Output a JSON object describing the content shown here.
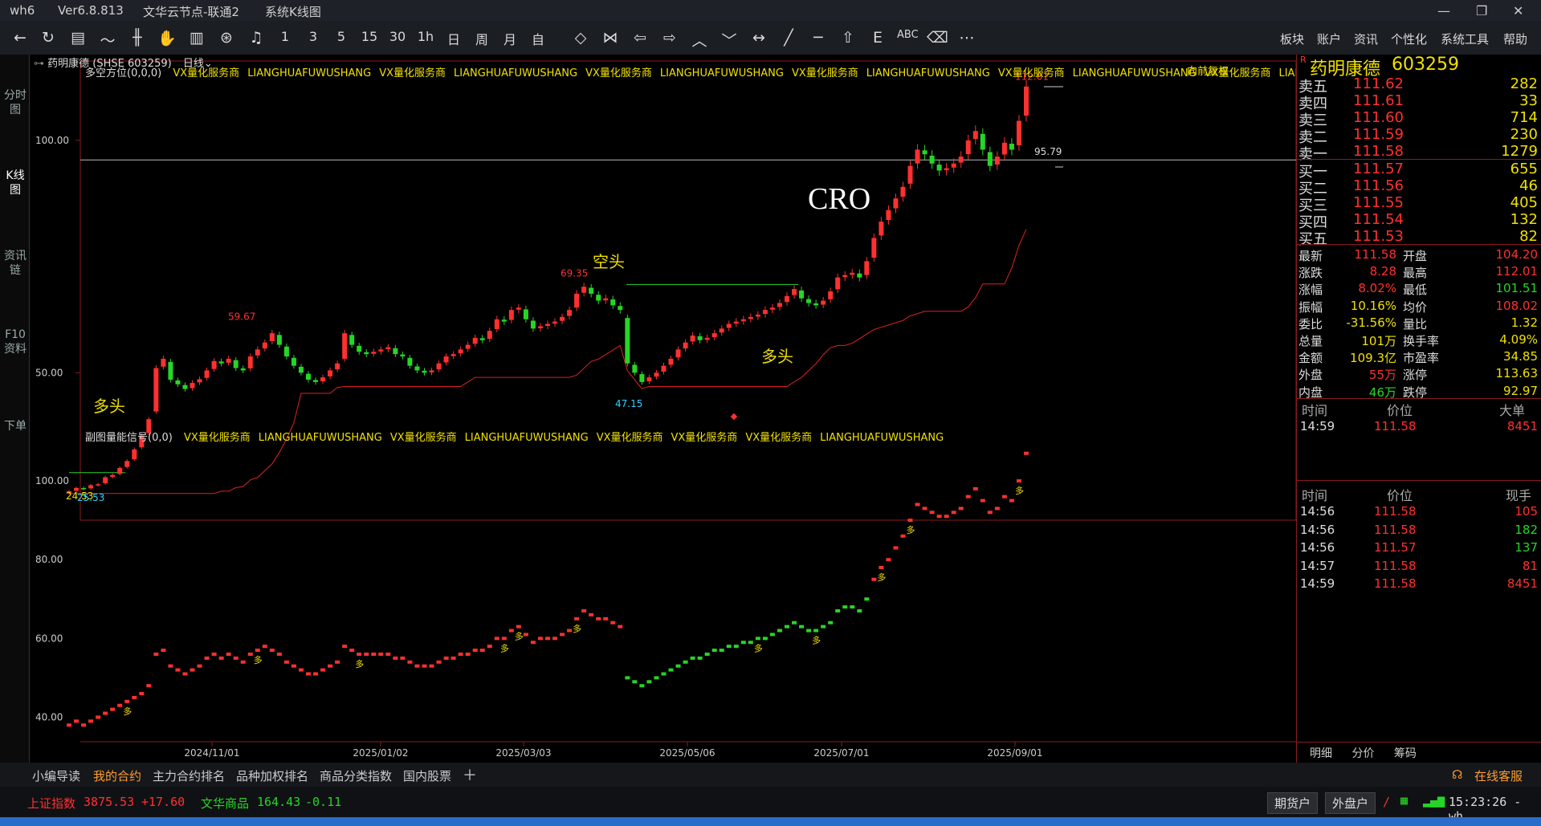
{
  "app": {
    "name": "wh6",
    "version": "Ver6.8.813",
    "server": "文华云节点-联通2",
    "view": "系统K线图"
  },
  "colors": {
    "up": "#ff3030",
    "down": "#26d626",
    "accent": "#f0e000",
    "bg": "#000000"
  },
  "toolbar": {
    "icons": [
      "back-icon",
      "refresh-icon",
      "table-icon",
      "line-chart-icon",
      "candle-icon",
      "hand-icon",
      "draw-icon",
      "speed-icon",
      "bell-icon"
    ],
    "periods": [
      "1",
      "3",
      "5",
      "15",
      "30",
      "1h",
      "日",
      "周",
      "月",
      "自"
    ],
    "menu": [
      "板块",
      "账户",
      "资讯",
      "个性化",
      "系统工具",
      "帮助"
    ]
  },
  "left_tabs": [
    "分时图",
    "K线图",
    "资讯链",
    "F10资料",
    "下单"
  ],
  "header": {
    "symbol": "药明康德",
    "code": "(SHSE 603259)",
    "period": "日线"
  },
  "main_chart": {
    "indicator": "多空方位(0,0,0)",
    "ad_text": [
      "VX量化服务商",
      "LIANGHUAFUWUSHANG",
      "VX量化服务商",
      "LIANGHUAFUWUSHANG",
      "VX量化服务商",
      "LIANGHUAFUWUSHANG",
      "VX量化服务商",
      "LIANGHUAFUWUSHANG",
      "VX量化服务商",
      "LIANGHUAFUWUSHANG",
      "VX量化服务商",
      "LIANGHUAFUWUSHANG"
    ],
    "rights_label": "向前复权",
    "max_label": "112.01",
    "price_line_label": "95.79",
    "peak1": "59.67",
    "peak2": "69.35",
    "low1": "47.15",
    "low_start": "24.53",
    "low_start2": "25.53",
    "annotation_cro": "CRO",
    "annotation_short": "空头",
    "annotation_long": "多头",
    "annotation_long2": "多头"
  },
  "sub_chart": {
    "indicator": "副图量能信号(0,0)",
    "ad_text": [
      "VX量化服务商",
      "LIANGHUAFUWUSHANG",
      "VX量化服务商",
      "LIANGHUAFUWUSHANG",
      "VX量化服务商",
      "VX量化服务商",
      "VX量化服务商",
      "LIANGHUAFUWUSHANG"
    ],
    "yticks": [
      "100.00",
      "80.00",
      "60.00",
      "40.00"
    ],
    "signal": "多"
  },
  "xaxis": [
    "2024/11/01",
    "2025/01/02",
    "2025/03/03",
    "2025/05/06",
    "2025/07/01",
    "2025/09/01"
  ],
  "chart_data": {
    "type": "candlestick",
    "title": "药明康德 603259 日线",
    "yticks": [
      "100.00",
      "50.00"
    ],
    "closes": [
      24.5,
      25.2,
      25.0,
      25.8,
      26.0,
      27.5,
      28.0,
      29.5,
      31.0,
      33.5,
      36.5,
      40.0,
      51.0,
      53.0,
      48.5,
      47.5,
      46.5,
      47.8,
      48.6,
      50.5,
      52.5,
      52.0,
      53.0,
      51.0,
      50.5,
      53.5,
      55.0,
      56.5,
      58.5,
      56.0,
      53.5,
      51.5,
      50.0,
      48.5,
      48.0,
      49.0,
      50.5,
      52.0,
      58.5,
      56.0,
      54.5,
      54.0,
      54.5,
      55.0,
      55.5,
      54.0,
      53.5,
      51.5,
      50.5,
      50.0,
      50.5,
      52.0,
      53.5,
      54.0,
      55.0,
      56.0,
      57.5,
      57.0,
      59.0,
      61.5,
      61.0,
      63.5,
      64.0,
      61.5,
      59.5,
      60.0,
      60.5,
      61.0,
      62.0,
      63.5,
      67.0,
      68.5,
      67.0,
      65.5,
      66.0,
      64.5,
      63.5,
      52.0,
      50.0,
      48.0,
      49.0,
      50.0,
      51.5,
      53.0,
      55.0,
      56.5,
      58.0,
      57.0,
      57.5,
      58.5,
      59.5,
      60.5,
      61.0,
      61.5,
      62.0,
      62.5,
      63.5,
      64.0,
      65.0,
      66.5,
      68.0,
      66.0,
      65.0,
      64.5,
      65.5,
      67.5,
      70.5,
      71.0,
      71.5,
      70.5,
      74.0,
      79.0,
      82.5,
      85.0,
      87.5,
      90.0,
      94.5,
      98.0,
      97.0,
      95.0,
      93.5,
      94.0,
      95.0,
      96.5,
      100.0,
      102.0,
      98.0,
      94.5,
      96.5,
      99.5,
      98.0,
      104.2,
      111.58
    ],
    "price_range": [
      20,
      115
    ],
    "sub_values": [
      38,
      39,
      38,
      39,
      40,
      41,
      42,
      43,
      44,
      45,
      46,
      48,
      56,
      57,
      53,
      52,
      51,
      52,
      53,
      55,
      56,
      55,
      56,
      55,
      54,
      56,
      57,
      58,
      57,
      56,
      54,
      53,
      52,
      51,
      51,
      52,
      53,
      54,
      58,
      57,
      56,
      56,
      56,
      56,
      56,
      55,
      55,
      54,
      53,
      53,
      53,
      54,
      55,
      55,
      56,
      56,
      57,
      57,
      58,
      60,
      60,
      62,
      63,
      61,
      59,
      60,
      60,
      60,
      61,
      62,
      65,
      67,
      66,
      65,
      65,
      64,
      63,
      50,
      49,
      48,
      49,
      50,
      51,
      52,
      53,
      54,
      55,
      55,
      56,
      57,
      57,
      58,
      58,
      59,
      59,
      60,
      60,
      61,
      62,
      63,
      64,
      63,
      62,
      62,
      63,
      64,
      67,
      68,
      68,
      67,
      70,
      75,
      78,
      80,
      83,
      86,
      90,
      94,
      93,
      92,
      91,
      91,
      92,
      93,
      96,
      98,
      95,
      92,
      93,
      96,
      95,
      100,
      107
    ],
    "sub_range": [
      35,
      110
    ]
  },
  "quote": {
    "title": "药明康德",
    "code": "603259",
    "asks": [
      {
        "label": "卖五",
        "price": "111.62",
        "vol": "282"
      },
      {
        "label": "卖四",
        "price": "111.61",
        "vol": "33"
      },
      {
        "label": "卖三",
        "price": "111.60",
        "vol": "714"
      },
      {
        "label": "卖二",
        "price": "111.59",
        "vol": "230"
      },
      {
        "label": "卖一",
        "price": "111.58",
        "vol": "1279"
      }
    ],
    "bids": [
      {
        "label": "买一",
        "price": "111.57",
        "vol": "655"
      },
      {
        "label": "买二",
        "price": "111.56",
        "vol": "46"
      },
      {
        "label": "买三",
        "price": "111.55",
        "vol": "405"
      },
      {
        "label": "买四",
        "price": "111.54",
        "vol": "132"
      },
      {
        "label": "买五",
        "price": "111.53",
        "vol": "82"
      }
    ],
    "stats": [
      {
        "l1": "最新",
        "v1": "111.58",
        "c1": "red",
        "l2": "开盘",
        "v2": "104.20",
        "c2": "red"
      },
      {
        "l1": "涨跌",
        "v1": "8.28",
        "c1": "red",
        "l2": "最高",
        "v2": "112.01",
        "c2": "red"
      },
      {
        "l1": "涨幅",
        "v1": "8.02%",
        "c1": "red",
        "l2": "最低",
        "v2": "101.51",
        "c2": "green"
      },
      {
        "l1": "振幅",
        "v1": "10.16%",
        "c1": "yellow",
        "l2": "均价",
        "v2": "108.02",
        "c2": "red"
      },
      {
        "l1": "委比",
        "v1": "-31.56%",
        "c1": "yellow",
        "l2": "量比",
        "v2": "1.32",
        "c2": "yellow"
      },
      {
        "l1": "总量",
        "v1": "101万",
        "c1": "yellow",
        "l2": "换手率",
        "v2": "4.09%",
        "c2": "yellow"
      },
      {
        "l1": "金额",
        "v1": "109.3亿",
        "c1": "yellow",
        "l2": "市盈率",
        "v2": "34.85",
        "c2": "yellow"
      },
      {
        "l1": "外盘",
        "v1": "55万",
        "c1": "red",
        "l2": "涨停",
        "v2": "113.63",
        "c2": "yellow"
      },
      {
        "l1": "内盘",
        "v1": "46万",
        "c1": "green",
        "l2": "跌停",
        "v2": "92.97",
        "c2": "yellow"
      }
    ],
    "big_header": [
      "时间",
      "价位",
      "大单"
    ],
    "big_rows": [
      {
        "t": "14:59",
        "p": "111.58",
        "v": "8451"
      }
    ],
    "tick_header": [
      "时间",
      "价位",
      "现手"
    ],
    "ticks": [
      {
        "t": "14:56",
        "p": "111.58",
        "v": "105"
      },
      {
        "t": "14:56",
        "p": "111.58",
        "v": "182"
      },
      {
        "t": "14:56",
        "p": "111.57",
        "v": "137"
      },
      {
        "t": "14:57",
        "p": "111.58",
        "v": "81"
      },
      {
        "t": "14:59",
        "p": "111.58",
        "v": "8451"
      }
    ],
    "bottom_tabs": [
      "明细",
      "分价",
      "筹码"
    ]
  },
  "bottom_tabs": [
    "小编导读",
    "我的合约",
    "主力合约排名",
    "品种加权排名",
    "商品分类指数",
    "国内股票"
  ],
  "status": {
    "idx1_name": "上证指数",
    "idx1_val": "3875.53",
    "idx1_chg": "+17.60",
    "idx2_name": "文华商品",
    "idx2_val": "164.43",
    "idx2_chg": "-0.11",
    "btn1": "期货户",
    "btn2": "外盘户",
    "time": "15:23:26 - wh",
    "service": "在线客服"
  }
}
